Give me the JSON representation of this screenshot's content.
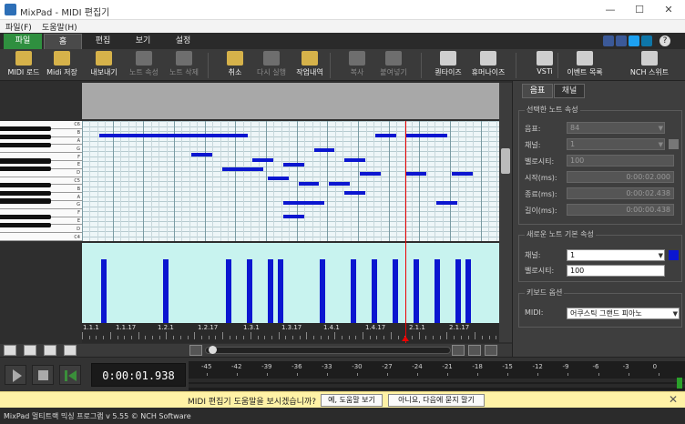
{
  "window": {
    "title": "MixPad - MIDI 편집기"
  },
  "menu": [
    "파일(F)",
    "도움말(H)"
  ],
  "tabs": [
    "파일",
    "홈",
    "편집",
    "보기",
    "설정"
  ],
  "toolbar": [
    {
      "label": "MIDI 로드",
      "icon": "folder-open-icon",
      "enabled": true
    },
    {
      "label": "Midi 저장",
      "icon": "save-icon",
      "enabled": true
    },
    {
      "label": "내보내기",
      "icon": "export-icon",
      "enabled": true
    },
    {
      "label": "노트 속성",
      "icon": "note-properties-icon",
      "enabled": false
    },
    {
      "label": "노트 삭제",
      "icon": "note-delete-icon",
      "enabled": false
    },
    {
      "label": "취소",
      "icon": "undo-icon",
      "enabled": true
    },
    {
      "label": "다시 실행",
      "icon": "redo-icon",
      "enabled": false
    },
    {
      "label": "작업내역",
      "icon": "history-icon",
      "enabled": true
    },
    {
      "label": "복사",
      "icon": "copy-icon",
      "enabled": false
    },
    {
      "label": "붙여넣기",
      "icon": "paste-icon",
      "enabled": false
    },
    {
      "label": "퀀타이즈",
      "icon": "quantize-icon",
      "enabled": true
    },
    {
      "label": "휴머나이즈",
      "icon": "humanize-icon",
      "enabled": true
    },
    {
      "label": "VSTi",
      "icon": "vsti-icon",
      "enabled": true
    },
    {
      "label": "이벤트 목록",
      "icon": "event-list-icon",
      "enabled": true
    },
    {
      "label": "NCH 스위트",
      "icon": "nch-suite-icon",
      "enabled": true
    }
  ],
  "piano": {
    "key_labels": [
      "C6",
      "B",
      "A",
      "G",
      "F",
      "E",
      "D",
      "C5",
      "B",
      "A",
      "G",
      "F",
      "E",
      "D",
      "C4"
    ]
  },
  "ruler": {
    "labels": [
      "1.1.1",
      "1.1.17",
      "1.2.1",
      "1.2.17",
      "1.3.1",
      "1.3.17",
      "1.4.1",
      "1.4.17",
      "2.1.1",
      "2.1.17"
    ]
  },
  "notes": [
    {
      "start": 0.5,
      "len": 1.5,
      "row": 2
    },
    {
      "start": 2.5,
      "len": 1.5,
      "row": 2
    },
    {
      "start": 4.0,
      "len": 1.0,
      "row": 2
    },
    {
      "start": 3.5,
      "len": 0.5,
      "row": 6
    },
    {
      "start": 4.5,
      "len": 1.0,
      "row": 9
    },
    {
      "start": 5.5,
      "len": 0.5,
      "row": 7
    },
    {
      "start": 6.0,
      "len": 0.5,
      "row": 11
    },
    {
      "start": 6.5,
      "len": 0.5,
      "row": 8
    },
    {
      "start": 6.5,
      "len": 1.0,
      "row": 16
    },
    {
      "start": 6.5,
      "len": 0.5,
      "row": 19
    },
    {
      "start": 7.0,
      "len": 0.5,
      "row": 12
    },
    {
      "start": 7.5,
      "len": 0.5,
      "row": 5
    },
    {
      "start": 8.0,
      "len": 0.5,
      "row": 12
    },
    {
      "start": 8.5,
      "len": 0.5,
      "row": 14
    },
    {
      "start": 8.5,
      "len": 0.5,
      "row": 7
    },
    {
      "start": 9.0,
      "len": 0.5,
      "row": 10
    },
    {
      "start": 9.5,
      "len": 0.5,
      "row": 2
    },
    {
      "start": 10.5,
      "len": 1.0,
      "row": 2
    },
    {
      "start": 10.5,
      "len": 0.5,
      "row": 10
    },
    {
      "start": 11.5,
      "len": 0.5,
      "row": 16
    },
    {
      "start": 12.0,
      "len": 0.5,
      "row": 10
    }
  ],
  "velocity_bars": [
    0.9,
    3.9,
    6.9,
    7.9,
    8.9,
    9.4,
    11.4,
    12.9,
    13.9,
    14.9,
    15.9,
    16.9,
    17.9,
    18.4
  ],
  "time_display": "0:00:01.938",
  "meter_labels": [
    "-45",
    "-42",
    "-39",
    "-36",
    "-33",
    "-30",
    "-27",
    "-24",
    "-21",
    "-18",
    "-15",
    "-12",
    "-9",
    "-6",
    "-3",
    "0"
  ],
  "panel": {
    "tabs": [
      "음표",
      "채널"
    ],
    "selected_title": "선택한 노트 속성",
    "fields": [
      {
        "label": "음표:",
        "value": "84"
      },
      {
        "label": "채널:",
        "value": "1"
      },
      {
        "label": "벨로시티:",
        "value": "100"
      },
      {
        "label": "시작(ms):",
        "value": "0:00:02.000"
      },
      {
        "label": "종료(ms):",
        "value": "0:00:02.438"
      },
      {
        "label": "길이(ms):",
        "value": "0:00:00.438"
      }
    ],
    "default_title": "새로운 노트 기본 속성",
    "default_channel_label": "채널:",
    "default_channel": "1",
    "default_velocity_label": "벨로시티:",
    "default_velocity": "100",
    "keyboard_title": "키보드 옵션",
    "midi_label": "MIDI:",
    "midi_value": "어쿠스틱 그랜드 피아노",
    "accent": "#0b16d0"
  },
  "infobar": {
    "message": "MIDI 편집기 도움말을 보시겠습니까?",
    "yes": "예, 도움말 보기",
    "no": "아니요, 다음에 묻지 말기"
  },
  "status": "MixPad 멀티트랙 믹싱 프로그램 v 5.55 © NCH Software"
}
